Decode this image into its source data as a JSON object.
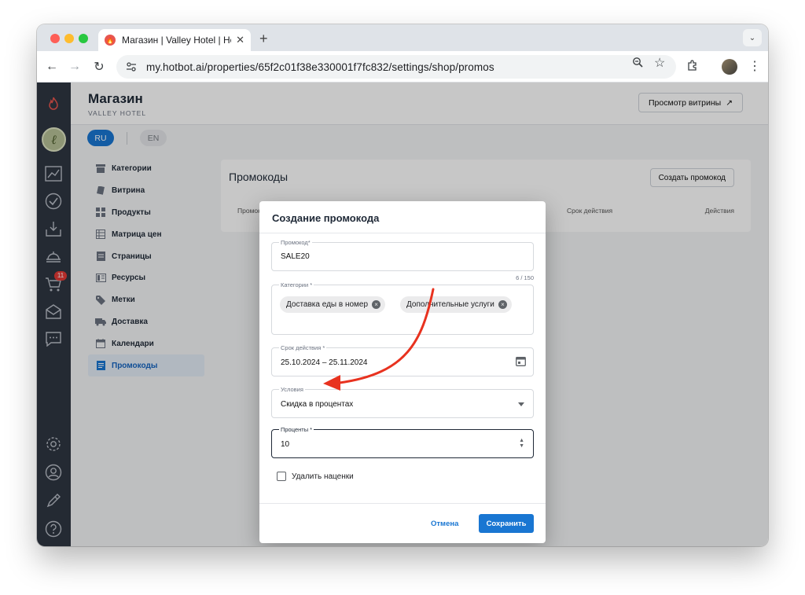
{
  "browser": {
    "tab_title": "Магазин | Valley Hotel | Hotbot",
    "tab_close": "✕",
    "new_tab": "+",
    "url": "my.hotbot.ai/properties/65f2c01f38e330001f7fc832/settings/shop/promos"
  },
  "header": {
    "title": "Магазин",
    "subtitle": "VALLEY HOTEL",
    "storefront_button": "Просмотр витрины",
    "storefront_arrow": "↗"
  },
  "languages": {
    "ru": "RU",
    "en": "EN"
  },
  "sidebar": {
    "cart_badge": "11"
  },
  "nav": {
    "items": [
      {
        "label": "Категории"
      },
      {
        "label": "Витрина"
      },
      {
        "label": "Продукты"
      },
      {
        "label": "Матрица цен"
      },
      {
        "label": "Страницы"
      },
      {
        "label": "Ресурсы"
      },
      {
        "label": "Метки"
      },
      {
        "label": "Доставка"
      },
      {
        "label": "Календари"
      },
      {
        "label": "Промокоды"
      }
    ]
  },
  "panel": {
    "title": "Промокоды",
    "create_button": "Создать промокод",
    "columns": [
      "Промокод",
      "Срок действия",
      "Действия"
    ]
  },
  "modal": {
    "title": "Создание промокода",
    "promo": {
      "label": "Промокод*",
      "value": "SALE20",
      "counter": "6 / 150"
    },
    "categories": {
      "label": "Категории *",
      "chips": [
        "Доставка еды в номер",
        "Дополнительные услуги"
      ]
    },
    "validity": {
      "label": "Срок действия *",
      "value": "25.10.2024 – 25.11.2024"
    },
    "conditions": {
      "label": "Условия",
      "value": "Скидка в процентах"
    },
    "percent": {
      "label": "Проценты *",
      "value": "10"
    },
    "remove_markups": "Удалить наценки",
    "cancel": "Отмена",
    "save": "Сохранить"
  },
  "colors": {
    "accent": "#1976d2",
    "sidebar": "#2f3642",
    "annotation_arrow": "#e8321f"
  }
}
